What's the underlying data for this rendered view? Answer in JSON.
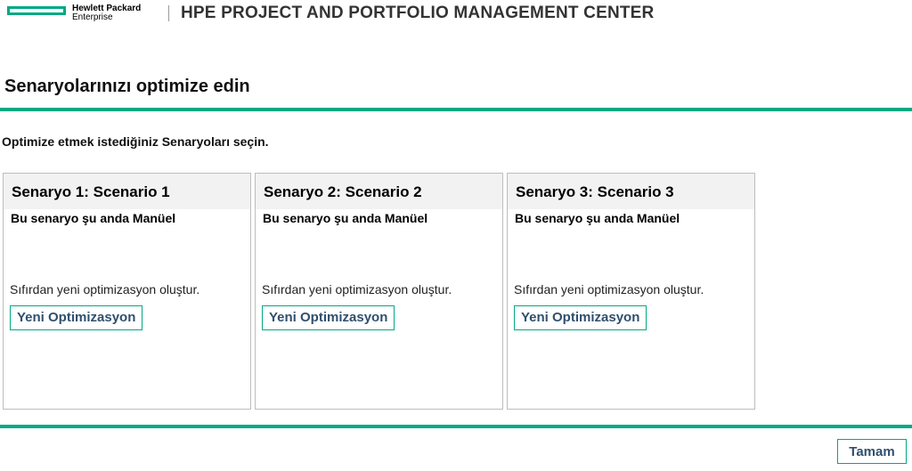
{
  "header": {
    "logo_line1": "Hewlett Packard",
    "logo_line2": "Enterprise",
    "app_title": "HPE PROJECT AND PORTFOLIO MANAGEMENT CENTER"
  },
  "page": {
    "title": "Senaryolarınızı optimize edin",
    "instruction": "Optimize etmek istediğiniz Senaryoları seçin."
  },
  "scenarios": [
    {
      "title": "Senaryo 1: Scenario 1",
      "status": "Bu senaryo şu anda Manüel",
      "description": "Sıfırdan yeni optimizasyon oluştur.",
      "button_label": "Yeni Optimizasyon"
    },
    {
      "title": "Senaryo 2: Scenario 2",
      "status": "Bu senaryo şu anda Manüel",
      "description": "Sıfırdan yeni optimizasyon oluştur.",
      "button_label": "Yeni Optimizasyon"
    },
    {
      "title": "Senaryo 3: Scenario 3",
      "status": "Bu senaryo şu anda Manüel",
      "description": "Sıfırdan yeni optimizasyon oluştur.",
      "button_label": "Yeni Optimizasyon"
    }
  ],
  "footer": {
    "ok_label": "Tamam"
  },
  "colors": {
    "accent": "#01a982",
    "button_text": "#2f4f6f",
    "card_header_bg": "#f2f2f2"
  }
}
